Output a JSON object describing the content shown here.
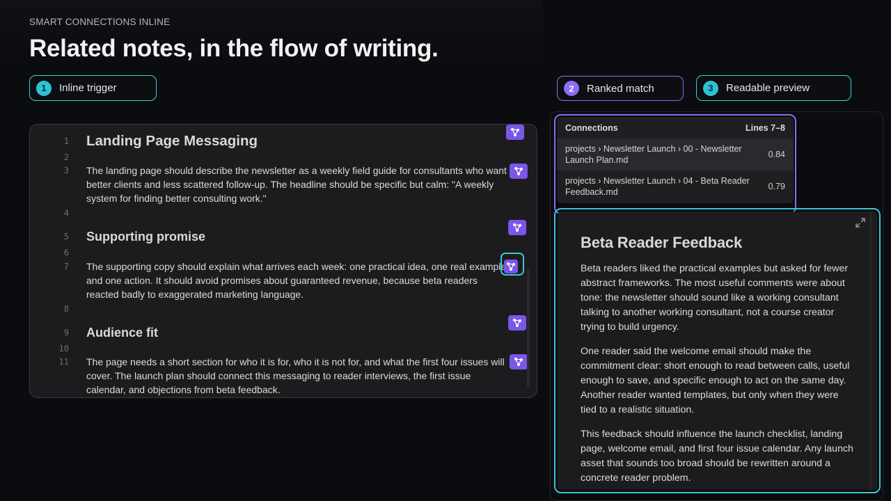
{
  "header": {
    "eyebrow": "SMART CONNECTIONS INLINE",
    "headline": "Related notes, in the flow of writing."
  },
  "steps": [
    {
      "num": "1",
      "label": "Inline trigger"
    },
    {
      "num": "2",
      "label": "Ranked match"
    },
    {
      "num": "3",
      "label": "Readable preview"
    }
  ],
  "editor": {
    "lines": [
      {
        "n": "1",
        "text": "Landing Page Messaging"
      },
      {
        "n": "2",
        "text": ""
      },
      {
        "n": "3",
        "text": "The landing page should describe the newsletter as a weekly field guide for consultants who want better clients and less scattered follow-up. The headline should be specific but calm: \"A weekly system for finding better consulting work.\""
      },
      {
        "n": "4",
        "text": ""
      },
      {
        "n": "5",
        "text": "Supporting promise"
      },
      {
        "n": "6",
        "text": ""
      },
      {
        "n": "7",
        "text": "The supporting copy should explain what arrives each week: one practical idea, one real example, and one action. It should avoid promises about guaranteed revenue, because beta readers reacted badly to exaggerated marketing language."
      },
      {
        "n": "8",
        "text": ""
      },
      {
        "n": "9",
        "text": "Audience fit"
      },
      {
        "n": "10",
        "text": ""
      },
      {
        "n": "11",
        "text": "The page needs a short section for who it is for, who it is not for, and what the first four issues will cover. The launch plan should connect this messaging to reader interviews, the first issue calendar, and objections from beta feedback."
      }
    ]
  },
  "connections": {
    "title": "Connections",
    "range": "Lines 7–8",
    "results": [
      {
        "path": "projects › Newsletter Launch › 00 - Newsletter Launch Plan.md",
        "score": "0.84"
      },
      {
        "path": "projects › Newsletter Launch › 04 - Beta Reader Feedback.md",
        "score": "0.79"
      }
    ]
  },
  "preview": {
    "title": "Beta Reader Feedback",
    "paragraphs": [
      "Beta readers liked the practical examples but asked for fewer abstract frameworks. The most useful comments were about tone: the newsletter should sound like a working consultant talking to another working consultant, not a course creator trying to build urgency.",
      "One reader said the welcome email should make the commitment clear: short enough to read between calls, useful enough to save, and specific enough to act on the same day. Another reader wanted templates, but only when they were tied to a realistic situation.",
      "This feedback should influence the launch checklist, landing page, welcome email, and first four issue calendar. Any launch asset that sounds too broad should be rewritten around a concrete reader problem."
    ]
  },
  "colors": {
    "cyan": "#3fd0de",
    "violet": "#8a6cf0",
    "button": "#7b56e8"
  },
  "icons": {
    "connections_button": "graph-nodes-icon",
    "expand": "expand-icon"
  }
}
